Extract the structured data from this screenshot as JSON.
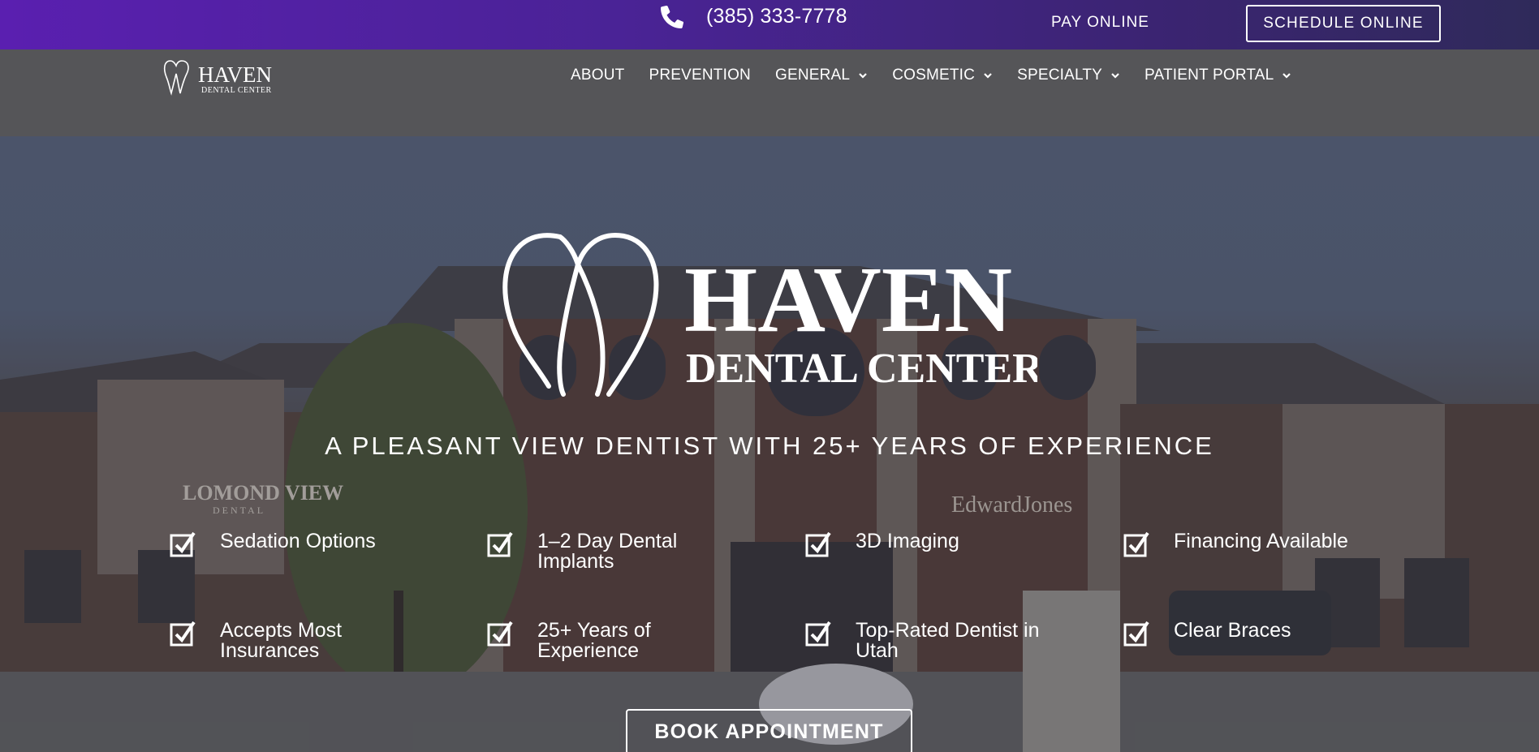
{
  "topbar": {
    "phone_icon": "phone-icon",
    "phone_number": "(385) 333-7778",
    "pay_online": "PAY ONLINE",
    "schedule_online": "SCHEDULE ONLINE",
    "gradient_start": "#5a1fb0",
    "gradient_end": "#2f2a5a"
  },
  "nav": {
    "logo": {
      "name": "HAVEN",
      "sub": "DENTAL CENTER"
    },
    "items": [
      {
        "label": "ABOUT",
        "has_dropdown": false
      },
      {
        "label": "PREVENTION",
        "has_dropdown": false
      },
      {
        "label": "GENERAL",
        "has_dropdown": true
      },
      {
        "label": "COSMETIC",
        "has_dropdown": true
      },
      {
        "label": "SPECIALTY",
        "has_dropdown": true
      },
      {
        "label": "PATIENT PORTAL",
        "has_dropdown": true
      }
    ],
    "background": "#555558"
  },
  "hero": {
    "logo": {
      "name": "HAVEN",
      "sub": "DENTAL CENTER"
    },
    "tagline": "A PLEASANT VIEW DENTIST WITH 25+ YEARS OF EXPERIENCE",
    "features": [
      {
        "label": "Sedation Options",
        "icon": "checkbox-icon"
      },
      {
        "label": "1–2 Day Dental Implants",
        "icon": "checkbox-icon"
      },
      {
        "label": "3D Imaging",
        "icon": "checkbox-icon"
      },
      {
        "label": "Financing Available",
        "icon": "checkbox-icon"
      },
      {
        "label": "Accepts Most Insurances",
        "icon": "checkbox-icon"
      },
      {
        "label": "25+ Years of Experience",
        "icon": "checkbox-icon"
      },
      {
        "label": "Top-Rated Dentist in Utah",
        "icon": "checkbox-icon"
      },
      {
        "label": "Clear Braces",
        "icon": "checkbox-icon"
      }
    ],
    "book_button": "BOOK APPOINTMENT",
    "photo_signs": {
      "left_sign": "LOMOND VIEW",
      "left_sign_sub": "DENTAL",
      "right_sign": "EdwardJones"
    }
  }
}
